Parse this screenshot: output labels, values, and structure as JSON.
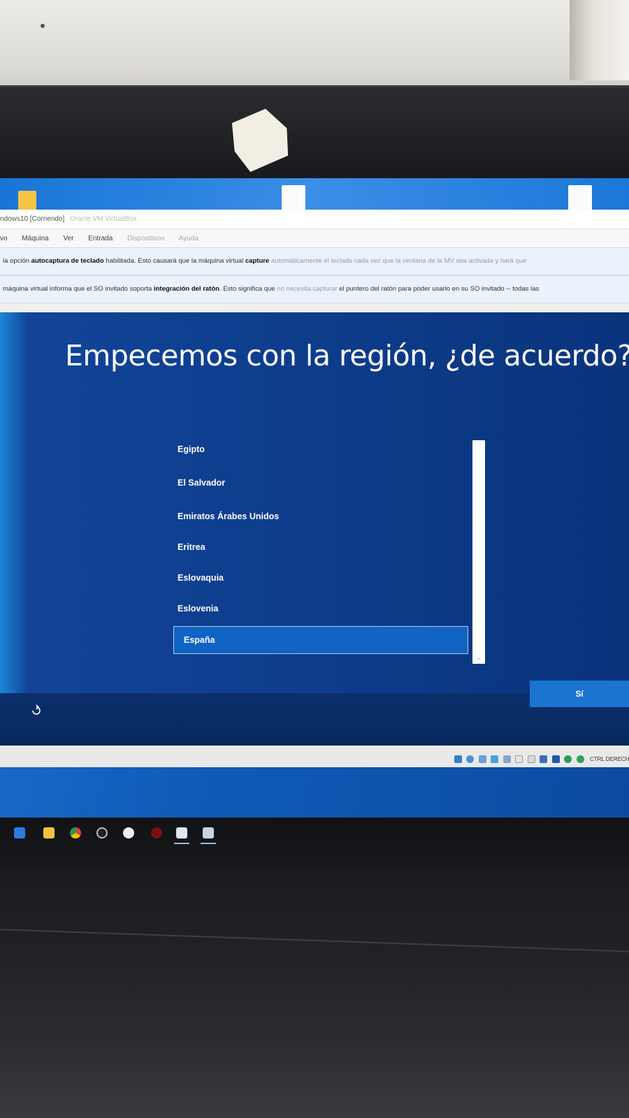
{
  "vm_window": {
    "title": "ndows10 [Corriendo]",
    "title_suffix": "Oracle VM VirtualBox",
    "menu": [
      "vo",
      "Máquina",
      "Ver",
      "Entrada",
      "Dispositivos",
      "Ayuda"
    ],
    "notice_keyboard": {
      "prefix": "la opción ",
      "bold": "autocaptura de teclado",
      "middle": " habilitada. Esto causará que la máquina virtual ",
      "bold2": "capture",
      "suffix_faded": " automáticamente el teclado cada vez que la ventana de la MV sea activada y hará que"
    },
    "notice_mouse": {
      "prefix": "máquina virtual informa que el SO invitado soporta ",
      "bold": "integración del ratón",
      "middle": ". Esto significa que ",
      "faded": "no necesita capturar",
      "suffix": " el puntero del ratón para poder usarlo en su SO invitado -- todas las"
    },
    "status_host_key": "CTRL DERECHA"
  },
  "oobe": {
    "title": "Empecemos con la región, ¿de acuerdo?",
    "regions": [
      "Egipto",
      "El Salvador",
      "Emiratos Árabes Unidos",
      "Eritrea",
      "Eslovaquia",
      "Eslovenia",
      "España"
    ],
    "selected_region": "España",
    "next_button": "Sí",
    "accessibility_icon": "accessibility-icon"
  },
  "colors": {
    "oobe_background": "#0d3d8c",
    "selection": "#0f63c5",
    "primary_button": "#1a74d0"
  },
  "taskbar": {
    "icons": [
      "mail-icon",
      "file-explorer-icon",
      "chrome-icon",
      "app-icon",
      "browser-icon",
      "record-icon",
      "virtualbox-icon",
      "vm-window-icon"
    ]
  }
}
